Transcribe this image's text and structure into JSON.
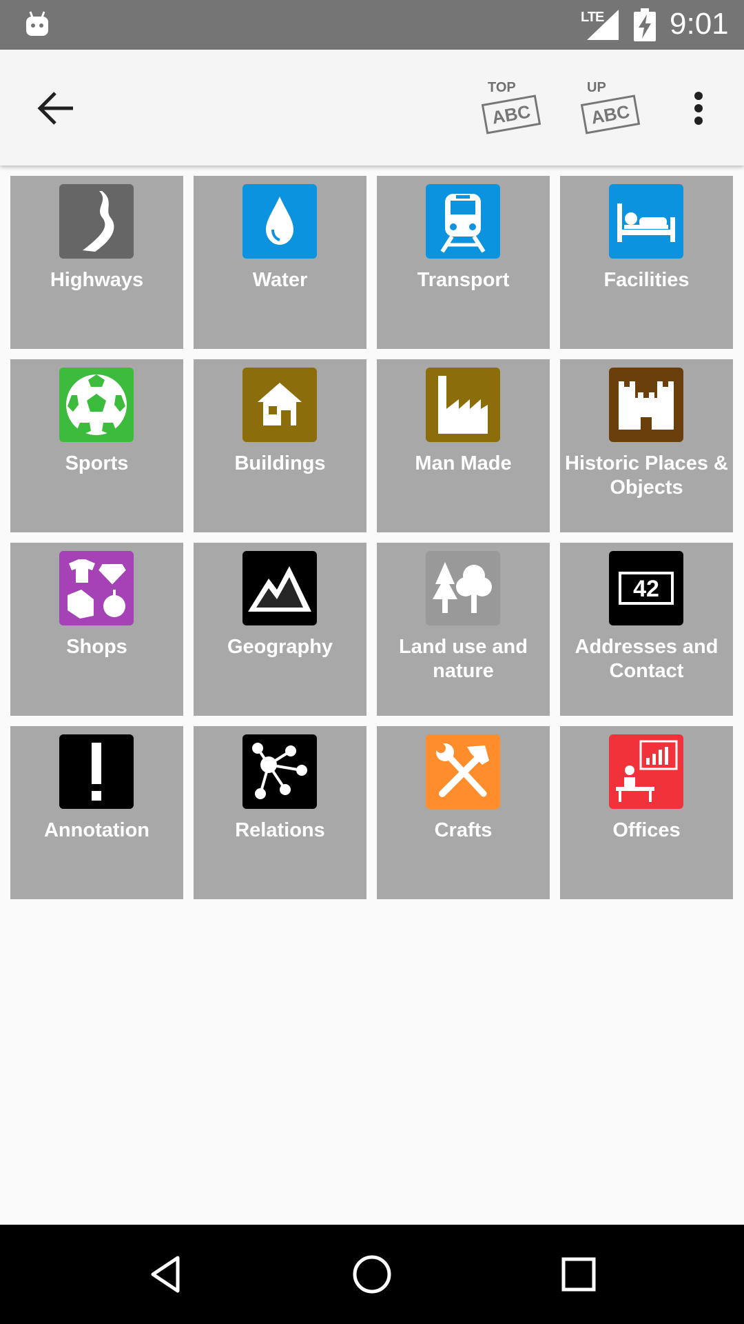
{
  "status_bar": {
    "network": "LTE",
    "time": "9:01",
    "icons": [
      "android-debug-icon",
      "signal-icon",
      "battery-charging-icon"
    ]
  },
  "toolbar": {
    "back_icon": "arrow-left-icon",
    "stamp_top": {
      "small": "TOP",
      "big": "ABC"
    },
    "stamp_up": {
      "small": "UP",
      "big": "ABC"
    },
    "overflow_icon": "more-vert-icon"
  },
  "categories": [
    {
      "label": "Highways",
      "icon": "road-icon",
      "color": "#666666"
    },
    {
      "label": "Water",
      "icon": "water-drop-icon",
      "color": "#0b93e0"
    },
    {
      "label": "Transport",
      "icon": "train-icon",
      "color": "#0b93e0"
    },
    {
      "label": "Facilities",
      "icon": "bed-icon",
      "color": "#0b93e0"
    },
    {
      "label": "Sports",
      "icon": "soccer-ball-icon",
      "color": "#3dbb3d"
    },
    {
      "label": "Buildings",
      "icon": "house-icon",
      "color": "#8b6d0c"
    },
    {
      "label": "Man Made",
      "icon": "factory-icon",
      "color": "#8b6d0c"
    },
    {
      "label": "Historic Places & Objects",
      "icon": "castle-icon",
      "color": "#6a3f0c"
    },
    {
      "label": "Shops",
      "icon": "shop-items-icon",
      "color": "#a442b6"
    },
    {
      "label": "Geography",
      "icon": "mountain-icon",
      "color": "#000000"
    },
    {
      "label": "Land use and nature",
      "icon": "trees-icon",
      "color": "#999999"
    },
    {
      "label": "Addresses and Contact",
      "icon": "address-number-icon",
      "color": "#000000"
    },
    {
      "label": "Annotation",
      "icon": "exclamation-icon",
      "color": "#000000"
    },
    {
      "label": "Relations",
      "icon": "relations-network-icon",
      "color": "#000000"
    },
    {
      "label": "Crafts",
      "icon": "tools-icon",
      "color": "#ff8d2c"
    },
    {
      "label": "Offices",
      "icon": "office-icon",
      "color": "#f1323a"
    }
  ],
  "address_icon_text": "42",
  "nav_bar": {
    "icons": [
      "nav-back-icon",
      "nav-home-icon",
      "nav-recents-icon"
    ]
  }
}
